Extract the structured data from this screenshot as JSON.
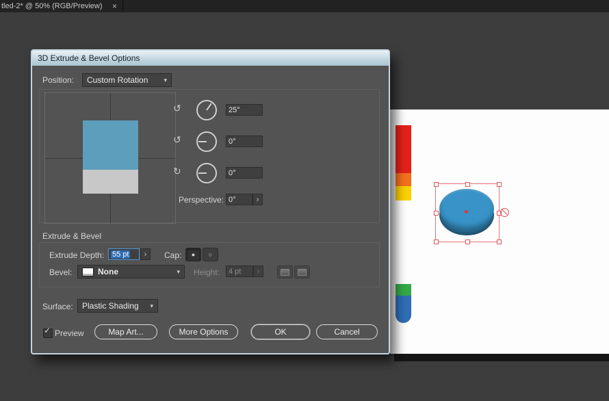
{
  "window": {
    "tab_title": "tled-2* @ 50% (RGB/Preview)",
    "close_glyph": "×"
  },
  "dialog": {
    "title": "3D Extrude & Bevel Options",
    "position": {
      "label": "Position:",
      "value": "Custom Rotation"
    },
    "rotation": {
      "x_value": "25°",
      "y_value": "0°",
      "z_value": "0°"
    },
    "perspective": {
      "label": "Perspective:",
      "value": "0°"
    },
    "extrude": {
      "section_title": "Extrude & Bevel",
      "depth_label": "Extrude Depth:",
      "depth_value": "55 pt",
      "cap_label": "Cap:",
      "bevel_label": "Bevel:",
      "bevel_value": "None",
      "height_label": "Height:",
      "height_value": "4 pt"
    },
    "surface": {
      "label": "Surface:",
      "value": "Plastic Shading"
    },
    "footer": {
      "preview": "Preview",
      "map_art": "Map Art...",
      "more_options": "More Options",
      "ok": "OK",
      "cancel": "Cancel"
    }
  },
  "icons": {
    "dropdown_chevron": "▾",
    "spinner_chevron": "›",
    "rotate_x": "↺",
    "rotate_y": "↺",
    "rotate_z": "↻",
    "cap_solid": "●",
    "cap_hollow": "○",
    "checkmark": "✓"
  },
  "colors": {
    "selection_highlight": "#2f6cb3",
    "artwork_red": "#e3211a",
    "artwork_orange": "#f3701d",
    "artwork_yellow": "#fcd000",
    "artwork_green": "#35a948",
    "artwork_blue": "#2f6eb6",
    "disk_top": "#3793c8",
    "disk_side": "#2b6e95",
    "selection_red": "#e57373"
  }
}
